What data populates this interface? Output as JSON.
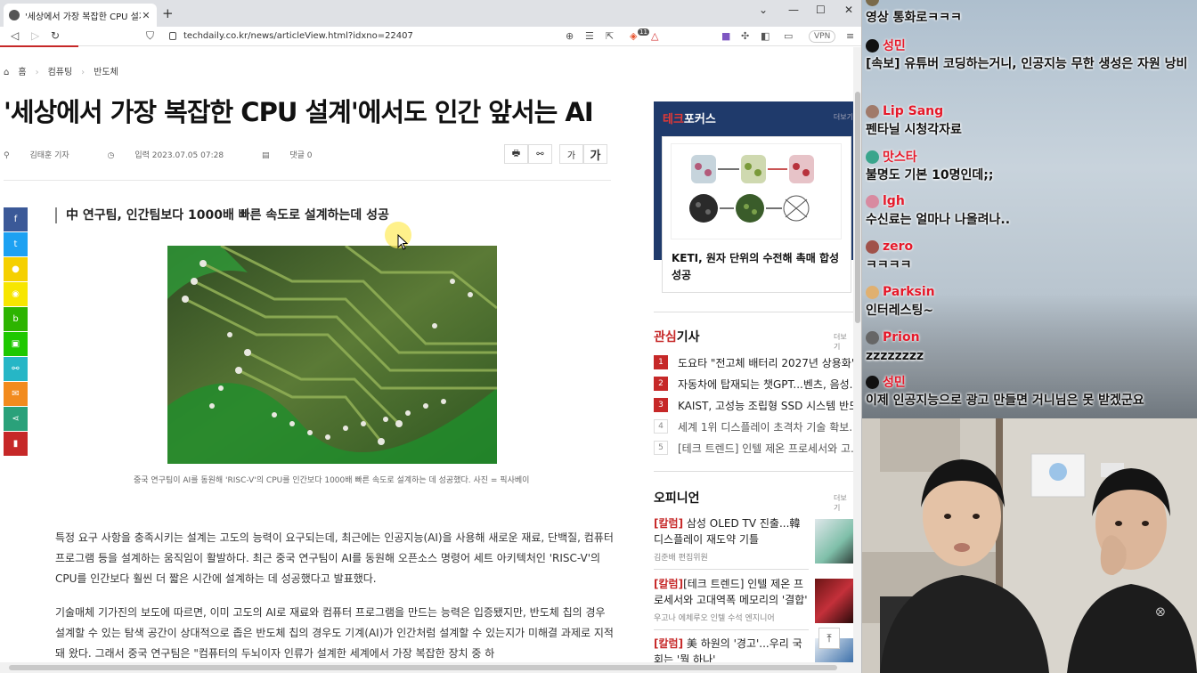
{
  "browser": {
    "tab_title": "'세상에서 가장 복잡한 CPU 설계",
    "url": "techdaily.co.kr/news/articleView.html?idxno=22407",
    "vpn_label": "VPN",
    "shield_count": "11"
  },
  "page": {
    "breadcrumb": [
      "홈",
      "컴퓨팅",
      "반도체"
    ],
    "title": "'세상에서 가장 복잡한 CPU 설계'에서도 인간 앞서는 AI",
    "author": "김태훈 기자",
    "date": "입력 2023.07.05 07:28",
    "comments": "댓글 0",
    "font_small": "가",
    "font_large": "가",
    "subhead": "中 연구팀, 인간팀보다 1000배 빠른 속도로 설계하는데 성공",
    "caption": "중국 연구팀이 AI를 동원해 'RISC-V'의 CPU를 인간보다 1000배 빠른 속도로 설계하는 데 성공했다. 사진 = 픽사베이",
    "paragraphs": [
      "특정 요구 사항을 충족시키는 설계는 고도의 능력이 요구되는데, 최근에는 인공지능(AI)을 사용해 새로운 재료, 단백질, 컴퓨터 프로그램 등을 설계하는 움직임이 활발하다. 최근 중국 연구팀이 AI를 동원해 오픈소스 명령어 세트 아키텍처인 'RISC-V'의 CPU를 인간보다 훨씬 더 짧은 시간에 설계하는 데 성공했다고 발표했다.",
      "기술매체 기가진의 보도에 따르면, 이미 고도의 AI로 재료와 컴퓨터 프로그램을 만드는 능력은 입증됐지만, 반도체 칩의 경우 설계할 수 있는 탐색 공간이 상대적으로 좁은 반도체 칩의 경우도 기계(AI)가 인간처럼 설계할 수 있는지가 미해결 과제로 지적돼 왔다. 그래서 중국 연구팀은 \"컴퓨터의 두뇌이자 인류가 설계한 세계에서 가장 복잡한 장치 중 하"
    ]
  },
  "sidebar": {
    "focus_title_red": "테크",
    "focus_title_white": "포커스",
    "focus_more": "더보기",
    "focus_article": "KETI, 원자 단위의 수전해 촉매 합성 성공",
    "interest_title_red": "관심",
    "interest_title_black": "기사",
    "interest_more": "더보기",
    "interest_items": [
      {
        "rank": "1",
        "title": "도요타 \"전고체 배터리 2027년 상용화\""
      },
      {
        "rank": "2",
        "title": "자동차에 탑재되는 챗GPT...벤츠, 음성..."
      },
      {
        "rank": "3",
        "title": "KAIST, 고성능 조립형 SSD 시스템 반도..."
      },
      {
        "rank": "4",
        "title": "세계 1위 디스플레이 초격차 기술 확보..."
      },
      {
        "rank": "5",
        "title": "[테크 트렌드] 인텔 제온 프로세서와 고..."
      }
    ],
    "opinion_title": "오피니언",
    "opinion_more": "더보기",
    "opinions": [
      {
        "tag": "[칼럼]",
        "title": " 삼성 OLED TV 진출...韓 디스플레이 재도약 기틀",
        "author": "김준배 편집위원"
      },
      {
        "tag": "[칼럼]",
        "title": "[테크 트렌드] 인텔 제온 프로세서와 고대역폭 메모리의 '결합'",
        "author": "우고나 에체루오 인텔 수석 엔지니어"
      },
      {
        "tag": "[칼럼]",
        "title": " 美 하원의 '경고'...우리 국회는 '뭘 하나'",
        "author": ""
      }
    ]
  },
  "chat": [
    {
      "user": "",
      "text": "영상 통화로ㅋㅋㅋ",
      "color": "#e5192a"
    },
    {
      "user": "성민",
      "text": "[속보] 유튜버 코딩하는거니, 인공지능 무한 생성은 자원 낭비",
      "color": "#e5192a"
    },
    {
      "user": "Lip Sang",
      "text": "펜타닐 시청각자료",
      "color": "#e5192a"
    },
    {
      "user": "맛스타",
      "text": "불명도 기본 10명인데;;",
      "color": "#e5192a"
    },
    {
      "user": "lgh",
      "text": "수신료는 얼마나 나올려나..",
      "color": "#e5192a"
    },
    {
      "user": "zero",
      "text": "ㅋㅋㅋㅋ",
      "color": "#e5192a"
    },
    {
      "user": "Parksin",
      "text": "인터레스팅~",
      "color": "#e5192a"
    },
    {
      "user": "Prion",
      "text": "zzzzzzzz",
      "color": "#e5192a"
    },
    {
      "user": "성민",
      "text": "이제 인공지능으로 광고 만들면 거니님은 못 받겠군요",
      "color": "#e5192a"
    }
  ],
  "colors": {
    "accent_red": "#c62828",
    "focus_navy": "#1f3a6b",
    "chat_username": "#e5192a"
  }
}
